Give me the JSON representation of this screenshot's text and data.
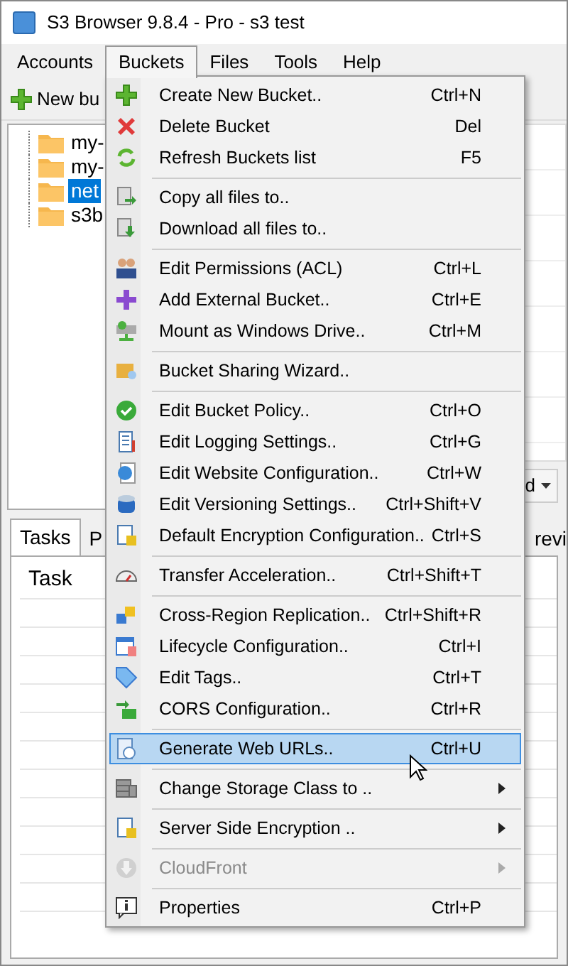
{
  "window": {
    "title": "S3 Browser 9.8.4 - Pro - s3 test"
  },
  "menubar": [
    {
      "label": "Accounts",
      "selected": false
    },
    {
      "label": "Buckets",
      "selected": true
    },
    {
      "label": "Files",
      "selected": false
    },
    {
      "label": "Tools",
      "selected": false
    },
    {
      "label": "Help",
      "selected": false
    }
  ],
  "toolbar": {
    "new_bucket_button": "New bu"
  },
  "tree": {
    "items": [
      {
        "label": "my-",
        "selected": false
      },
      {
        "label": "my-",
        "selected": false
      },
      {
        "label": "net",
        "selected": true
      },
      {
        "label": "s3b",
        "selected": false
      }
    ]
  },
  "file_panel": {
    "dropdown_button": "d"
  },
  "tabs": [
    {
      "label": "Tasks",
      "selected": true
    },
    {
      "label": "P",
      "selected": false
    },
    {
      "label": "revi",
      "selected": false
    }
  ],
  "table": {
    "columns": [
      "Task"
    ]
  },
  "menu": {
    "items": [
      {
        "kind": "item",
        "label": "Create New Bucket..",
        "shortcut": "Ctrl+N",
        "selected": false,
        "disabled": false,
        "submenu": false
      },
      {
        "kind": "item",
        "label": "Delete Bucket",
        "shortcut": "Del",
        "selected": false,
        "disabled": false,
        "submenu": false
      },
      {
        "kind": "item",
        "label": "Refresh Buckets list",
        "shortcut": "F5",
        "selected": false,
        "disabled": false,
        "submenu": false
      },
      {
        "kind": "separator"
      },
      {
        "kind": "item",
        "label": "Copy all files to..",
        "selected": false,
        "disabled": false,
        "submenu": false
      },
      {
        "kind": "item",
        "label": "Download all files to..",
        "selected": false,
        "disabled": false,
        "submenu": false
      },
      {
        "kind": "separator"
      },
      {
        "kind": "item",
        "label": "Edit Permissions (ACL)",
        "shortcut": "Ctrl+L",
        "selected": false,
        "disabled": false,
        "submenu": false
      },
      {
        "kind": "item",
        "label": "Add External Bucket..",
        "shortcut": "Ctrl+E",
        "selected": false,
        "disabled": false,
        "submenu": false
      },
      {
        "kind": "item",
        "label": "Mount as Windows Drive..",
        "shortcut": "Ctrl+M",
        "selected": false,
        "disabled": false,
        "submenu": false
      },
      {
        "kind": "separator"
      },
      {
        "kind": "item",
        "label": "Bucket Sharing Wizard..",
        "selected": false,
        "disabled": false,
        "submenu": false
      },
      {
        "kind": "separator"
      },
      {
        "kind": "item",
        "label": "Edit Bucket Policy..",
        "shortcut": "Ctrl+O",
        "selected": false,
        "disabled": false,
        "submenu": false
      },
      {
        "kind": "item",
        "label": "Edit Logging Settings..",
        "shortcut": "Ctrl+G",
        "selected": false,
        "disabled": false,
        "submenu": false
      },
      {
        "kind": "item",
        "label": "Edit Website Configuration..",
        "shortcut": "Ctrl+W",
        "selected": false,
        "disabled": false,
        "submenu": false
      },
      {
        "kind": "item",
        "label": "Edit Versioning Settings..",
        "shortcut": "Ctrl+Shift+V",
        "selected": false,
        "disabled": false,
        "submenu": false
      },
      {
        "kind": "item",
        "label": "Default Encryption Configuration..",
        "shortcut": "Ctrl+S",
        "selected": false,
        "disabled": false,
        "submenu": false
      },
      {
        "kind": "separator"
      },
      {
        "kind": "item",
        "label": "Transfer Acceleration..",
        "shortcut": "Ctrl+Shift+T",
        "selected": false,
        "disabled": false,
        "submenu": false
      },
      {
        "kind": "separator"
      },
      {
        "kind": "item",
        "label": "Cross-Region Replication..",
        "shortcut": "Ctrl+Shift+R",
        "selected": false,
        "disabled": false,
        "submenu": false
      },
      {
        "kind": "item",
        "label": "Lifecycle Configuration..",
        "shortcut": "Ctrl+I",
        "selected": false,
        "disabled": false,
        "submenu": false
      },
      {
        "kind": "item",
        "label": "Edit Tags..",
        "shortcut": "Ctrl+T",
        "selected": false,
        "disabled": false,
        "submenu": false
      },
      {
        "kind": "item",
        "label": "CORS Configuration..",
        "shortcut": "Ctrl+R",
        "selected": false,
        "disabled": false,
        "submenu": false
      },
      {
        "kind": "separator"
      },
      {
        "kind": "item",
        "label": "Generate Web URLs..",
        "shortcut": "Ctrl+U",
        "selected": true,
        "disabled": false,
        "submenu": false
      },
      {
        "kind": "separator"
      },
      {
        "kind": "item",
        "label": "Change Storage Class to ..",
        "selected": false,
        "disabled": false,
        "submenu": true
      },
      {
        "kind": "separator"
      },
      {
        "kind": "item",
        "label": "Server Side Encryption ..",
        "selected": false,
        "disabled": false,
        "submenu": true
      },
      {
        "kind": "separator"
      },
      {
        "kind": "item",
        "label": "CloudFront",
        "selected": false,
        "disabled": true,
        "submenu": true
      },
      {
        "kind": "separator"
      },
      {
        "kind": "item",
        "label": "Properties",
        "shortcut": "Ctrl+P",
        "selected": false,
        "disabled": false,
        "submenu": false
      }
    ]
  }
}
